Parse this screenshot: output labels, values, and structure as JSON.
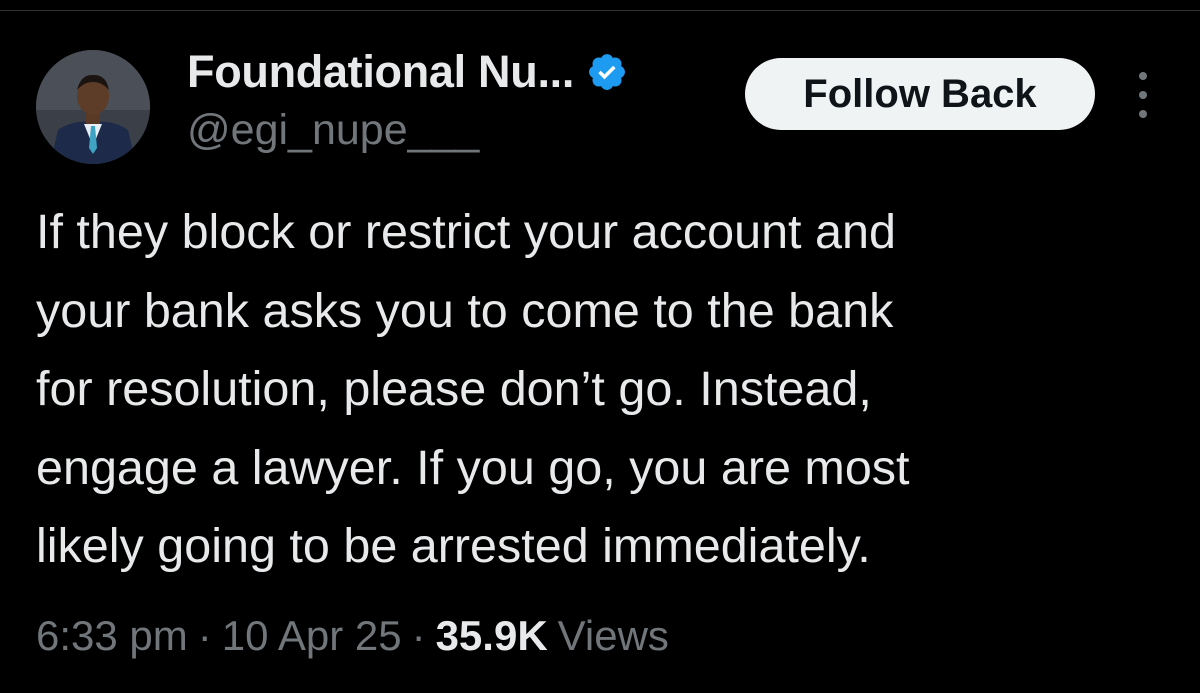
{
  "author": {
    "display_name": "Foundational Nu...",
    "handle": "@egi_nupe___",
    "verified_icon": "verified-badge-icon",
    "avatar": "profile-avatar"
  },
  "actions": {
    "follow_label": "Follow Back",
    "more_icon": "more-vertical-icon"
  },
  "tweet": {
    "lines": [
      "If they block or restrict your account and",
      "your bank asks you to come to the bank",
      "for resolution, please don’t go. Instead,",
      "engage a lawyer. If you go, you are most",
      "likely going to be arrested immediately."
    ]
  },
  "meta": {
    "time": "6:33 pm",
    "separator": "·",
    "date": "10 Apr 25",
    "views_count": "35.9K",
    "views_label": "Views"
  },
  "colors": {
    "background": "#000000",
    "text_primary": "#e7e9ea",
    "text_secondary": "#71767b",
    "verified_blue": "#1d9bf0",
    "button_bg": "#eff3f4",
    "button_text": "#0f1419"
  }
}
